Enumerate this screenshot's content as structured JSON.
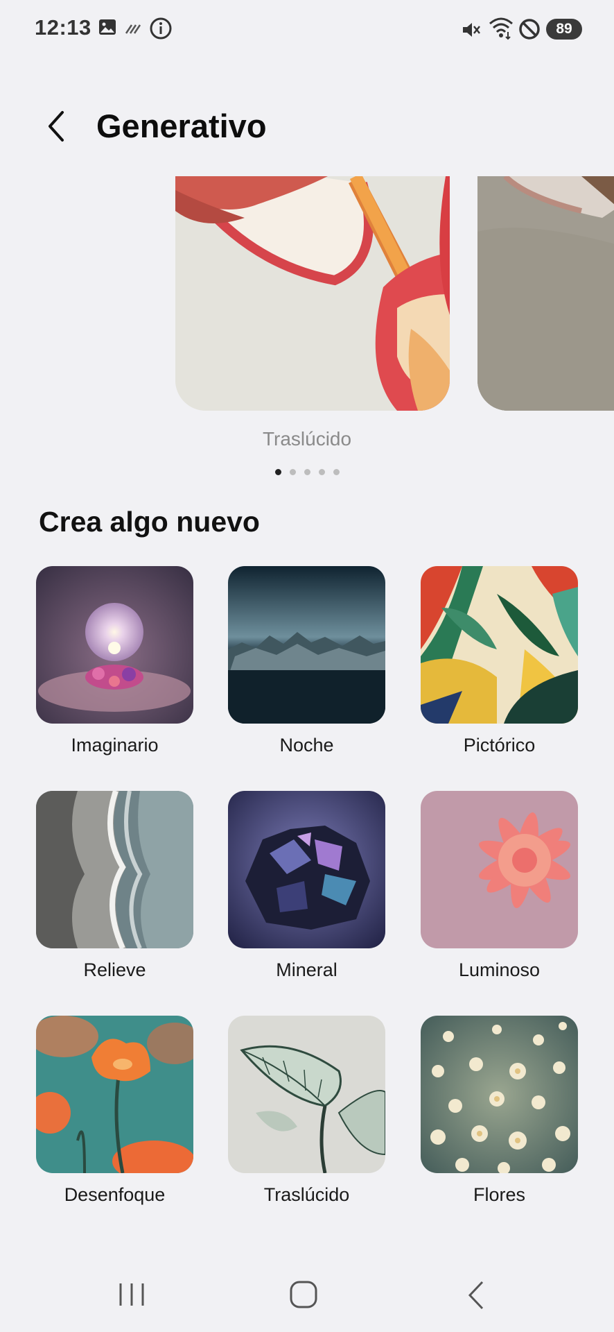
{
  "status_bar": {
    "time": "12:13",
    "battery": "89",
    "left_icons": [
      "gallery-icon",
      "signal-hatch-icon",
      "info-icon"
    ],
    "right_icons": [
      "mute-icon",
      "wifi-icon",
      "do-not-disturb-icon"
    ]
  },
  "header": {
    "title": "Generativo"
  },
  "carousel": {
    "current_label": "Traslúcido",
    "page_count": 5,
    "active_index": 0
  },
  "section": {
    "title": "Crea algo nuevo"
  },
  "styles": [
    {
      "label": "Imaginario"
    },
    {
      "label": "Noche"
    },
    {
      "label": "Pictórico"
    },
    {
      "label": "Relieve"
    },
    {
      "label": "Mineral"
    },
    {
      "label": "Luminoso"
    },
    {
      "label": "Desenfoque"
    },
    {
      "label": "Traslúcido"
    },
    {
      "label": "Flores"
    }
  ],
  "nav_bar": {
    "icons": [
      "recents-icon",
      "home-icon",
      "back-icon"
    ]
  }
}
